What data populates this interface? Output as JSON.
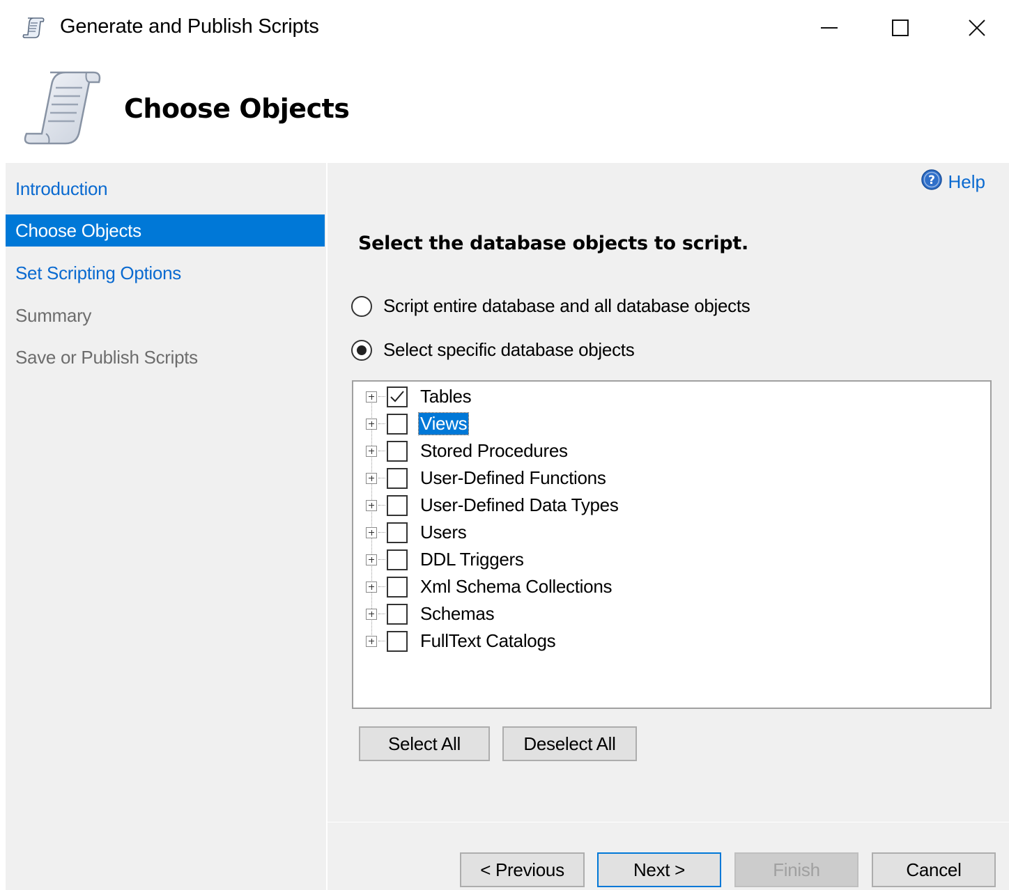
{
  "window": {
    "title": "Generate and Publish Scripts",
    "controls": [
      "minimize",
      "maximize",
      "close"
    ]
  },
  "header": {
    "title": "Choose Objects",
    "icon": "script-scroll-icon"
  },
  "nav": {
    "items": [
      {
        "label": "Introduction",
        "state": "link"
      },
      {
        "label": "Choose Objects",
        "state": "active"
      },
      {
        "label": "Set Scripting Options",
        "state": "link"
      },
      {
        "label": "Summary",
        "state": "disabled"
      },
      {
        "label": "Save or Publish Scripts",
        "state": "disabled"
      }
    ]
  },
  "content": {
    "help_label": "Help",
    "instruction": "Select the database objects to script.",
    "radio_options": [
      {
        "label": "Script entire database and all database objects",
        "checked": false
      },
      {
        "label": "Select specific database objects",
        "checked": true
      }
    ],
    "tree_items": [
      {
        "label": "Tables",
        "checked": true,
        "selected": false
      },
      {
        "label": "Views",
        "checked": false,
        "selected": true
      },
      {
        "label": "Stored Procedures",
        "checked": false,
        "selected": false
      },
      {
        "label": "User-Defined Functions",
        "checked": false,
        "selected": false
      },
      {
        "label": "User-Defined Data Types",
        "checked": false,
        "selected": false
      },
      {
        "label": "Users",
        "checked": false,
        "selected": false
      },
      {
        "label": "DDL Triggers",
        "checked": false,
        "selected": false
      },
      {
        "label": "Xml Schema Collections",
        "checked": false,
        "selected": false
      },
      {
        "label": "Schemas",
        "checked": false,
        "selected": false
      },
      {
        "label": "FullText Catalogs",
        "checked": false,
        "selected": false
      }
    ],
    "select_all_label": "Select All",
    "deselect_all_label": "Deselect All"
  },
  "footer": {
    "previous_label": "< Previous",
    "next_label": "Next >",
    "finish_label": "Finish",
    "cancel_label": "Cancel"
  },
  "colors": {
    "accent": "#0078d7",
    "link": "#0a6ad0",
    "panel_bg": "#f0f0f0",
    "disabled_text": "#6d6d6d"
  }
}
